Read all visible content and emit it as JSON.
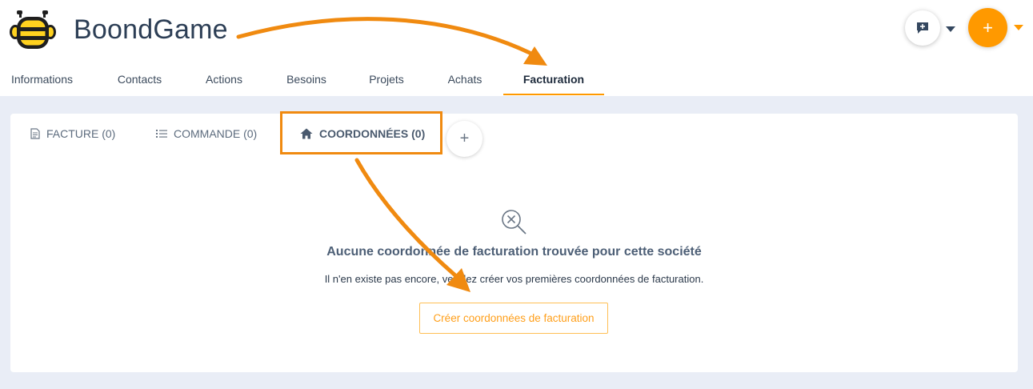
{
  "header": {
    "company_name": "BoondGame",
    "add_button": "+"
  },
  "main_tabs": [
    {
      "label": "Informations",
      "active": false
    },
    {
      "label": "Contacts",
      "active": false
    },
    {
      "label": "Actions",
      "active": false
    },
    {
      "label": "Besoins",
      "active": false
    },
    {
      "label": "Projets",
      "active": false
    },
    {
      "label": "Achats",
      "active": false
    },
    {
      "label": "Facturation",
      "active": true
    }
  ],
  "sub_tabs": [
    {
      "label": "FACTURE (0)",
      "icon": "invoice-icon",
      "active": false
    },
    {
      "label": "COMMANDE (0)",
      "icon": "list-icon",
      "active": false
    },
    {
      "label": "COORDONNÉES (0)",
      "icon": "home-icon",
      "active": true
    }
  ],
  "sub_add_button": "+",
  "empty_state": {
    "icon": "search-x-icon",
    "title": "Aucune coordonnée de facturation trouvée pour cette société",
    "description": "Il n'en existe pas encore, veuillez créer vos premières coordonnées de facturation.",
    "button_label": "Créer coordonnées de facturation"
  },
  "colors": {
    "accent": "#ff9900",
    "annotation": "#f08a10",
    "text_dark": "#2c3e55",
    "background": "#e9edf6"
  }
}
